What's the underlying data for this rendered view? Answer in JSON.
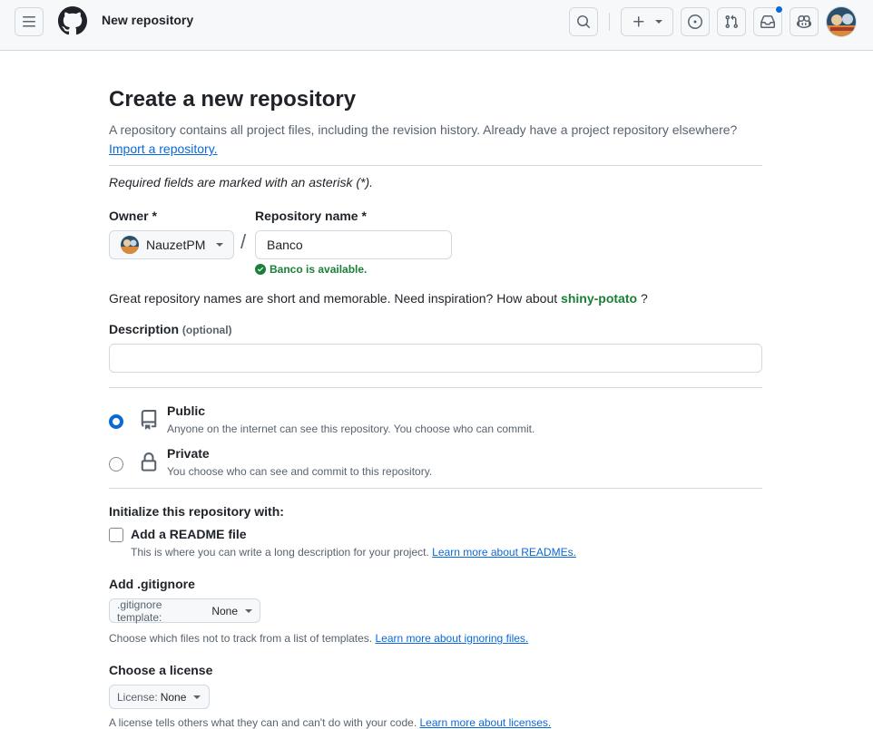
{
  "header": {
    "title": "New repository",
    "menu_icon": "three-bars-icon",
    "logo_icon": "github-mark-icon",
    "search_icon": "search-icon",
    "create_icon": "plus-icon",
    "issues_icon": "issue-opened-icon",
    "pulls_icon": "git-pull-request-icon",
    "inbox_icon": "inbox-icon",
    "copilot_icon": "copilot-icon"
  },
  "page": {
    "title": "Create a new repository",
    "subtitle": "A repository contains all project files, including the revision history. Already have a project repository elsewhere?",
    "import_link": "Import a repository.",
    "required_note": "Required fields are marked with an asterisk (*)."
  },
  "owner": {
    "label": "Owner *",
    "value": "NauzetPM"
  },
  "repo": {
    "label": "Repository name *",
    "value": "Banco",
    "available": "Banco is available."
  },
  "suggestion": {
    "prefix": "Great repository names are short and memorable. Need inspiration? How about",
    "name": "shiny-potato",
    "suffix": "?"
  },
  "description": {
    "label": "Description",
    "optional": "(optional)",
    "value": ""
  },
  "visibility": {
    "selected": "public",
    "public_title": "Public",
    "public_desc": "Anyone on the internet can see this repository. You choose who can commit.",
    "private_title": "Private",
    "private_desc": "You choose who can see and commit to this repository."
  },
  "init": {
    "heading": "Initialize this repository with:",
    "readme_label": "Add a README file",
    "readme_checked": false,
    "readme_hint": "This is where you can write a long description for your project.",
    "readme_link": "Learn more about READMEs."
  },
  "gitignore": {
    "heading": "Add .gitignore",
    "select_key": ".gitignore template:",
    "select_value": "None",
    "hint": "Choose which files not to track from a list of templates.",
    "link": "Learn more about ignoring files."
  },
  "license": {
    "heading": "Choose a license",
    "select_key": "License:",
    "select_value": "None",
    "hint": "A license tells others what they can and can't do with your code.",
    "link": "Learn more about licenses."
  },
  "colors": {
    "accent": "#0969da",
    "success": "#1a7f37",
    "border": "#d1d9e0",
    "header_bg": "#f6f8fa"
  }
}
